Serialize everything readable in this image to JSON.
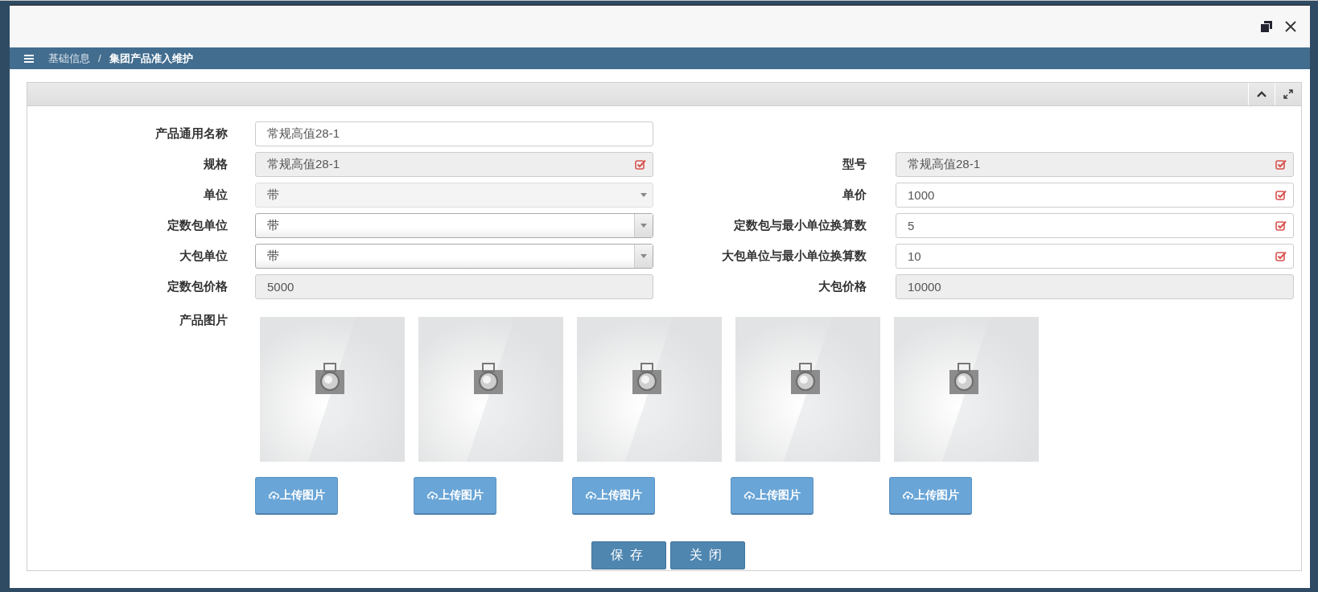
{
  "breadcrumb": {
    "separator": "/",
    "items": [
      {
        "label": "基础信息",
        "current": false
      },
      {
        "label": "集团产品准入维护",
        "current": true
      }
    ]
  },
  "form": {
    "rows": [
      {
        "fields": [
          {
            "label": "产品通用名称",
            "value": "常规高值28-1",
            "kind": "text",
            "readonly": false,
            "marked": false
          }
        ]
      },
      {
        "fields": [
          {
            "label": "规格",
            "value": "常规高值28-1",
            "kind": "text",
            "readonly": true,
            "marked": true
          },
          {
            "label": "型号",
            "value": "常规高值28-1",
            "kind": "text",
            "readonly": true,
            "marked": true
          }
        ]
      },
      {
        "fields": [
          {
            "label": "单位",
            "value": "带",
            "kind": "select",
            "readonly": true,
            "marked": false
          },
          {
            "label": "单价",
            "value": "1000",
            "kind": "text",
            "readonly": false,
            "marked": true
          }
        ]
      },
      {
        "fields": [
          {
            "label": "定数包单位",
            "value": "带",
            "kind": "select",
            "readonly": false,
            "marked": false
          },
          {
            "label": "定数包与最小单位换算数",
            "value": "5",
            "kind": "text",
            "readonly": false,
            "marked": true
          }
        ]
      },
      {
        "fields": [
          {
            "label": "大包单位",
            "value": "带",
            "kind": "select",
            "readonly": false,
            "marked": false
          },
          {
            "label": "大包单位与最小单位换算数",
            "value": "10",
            "kind": "text",
            "readonly": false,
            "marked": true
          }
        ]
      },
      {
        "fields": [
          {
            "label": "定数包价格",
            "value": "5000",
            "kind": "text",
            "readonly": true,
            "marked": false
          },
          {
            "label": "大包价格",
            "value": "10000",
            "kind": "text",
            "readonly": true,
            "marked": false
          }
        ]
      }
    ]
  },
  "pictures": {
    "label": "产品图片",
    "items": [
      {
        "kind": "picture",
        "button": "上传图片"
      },
      {
        "kind": "picture",
        "button": "上传图片"
      },
      {
        "kind": "picture",
        "button": "上传图片"
      },
      {
        "kind": "picture",
        "button": "上传图片"
      },
      {
        "kind": "picture",
        "button": "上传图片"
      }
    ]
  },
  "actions": [
    "保存",
    "关闭"
  ]
}
